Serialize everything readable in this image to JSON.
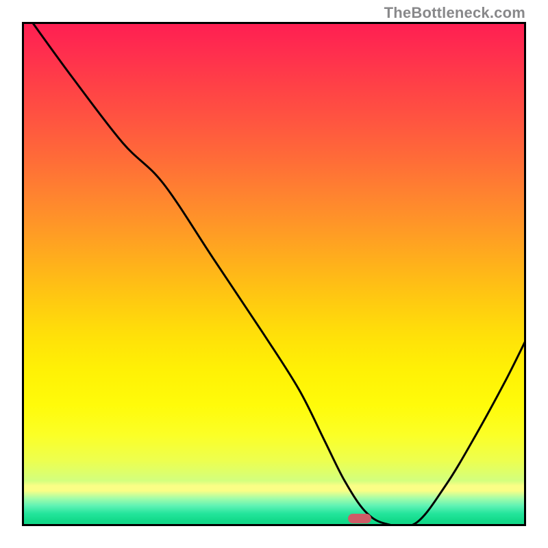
{
  "watermark": "TheBottleneck.com",
  "colors": {
    "curve": "#000000",
    "marker": "#cd5d67",
    "border": "#000000",
    "gradient_top": "#ff1e52",
    "gradient_bottom": "#12d989"
  },
  "chart_data": {
    "type": "line",
    "title": "",
    "xlabel": "",
    "ylabel": "",
    "xlim": [
      0,
      100
    ],
    "ylim": [
      0,
      100
    ],
    "series": [
      {
        "name": "bottleneck-curve",
        "x": [
          2,
          10,
          20,
          28,
          38,
          48,
          55,
          60,
          64,
          68,
          72,
          78,
          84,
          90,
          96,
          100
        ],
        "y": [
          100,
          89,
          76,
          68,
          53,
          38,
          27,
          17,
          9,
          3,
          0.5,
          0.5,
          8,
          18,
          29,
          37
        ]
      }
    ],
    "marker": {
      "x_frac": 0.67,
      "y_frac": 0.985
    },
    "background": "vertical heat gradient red→yellow→green"
  }
}
